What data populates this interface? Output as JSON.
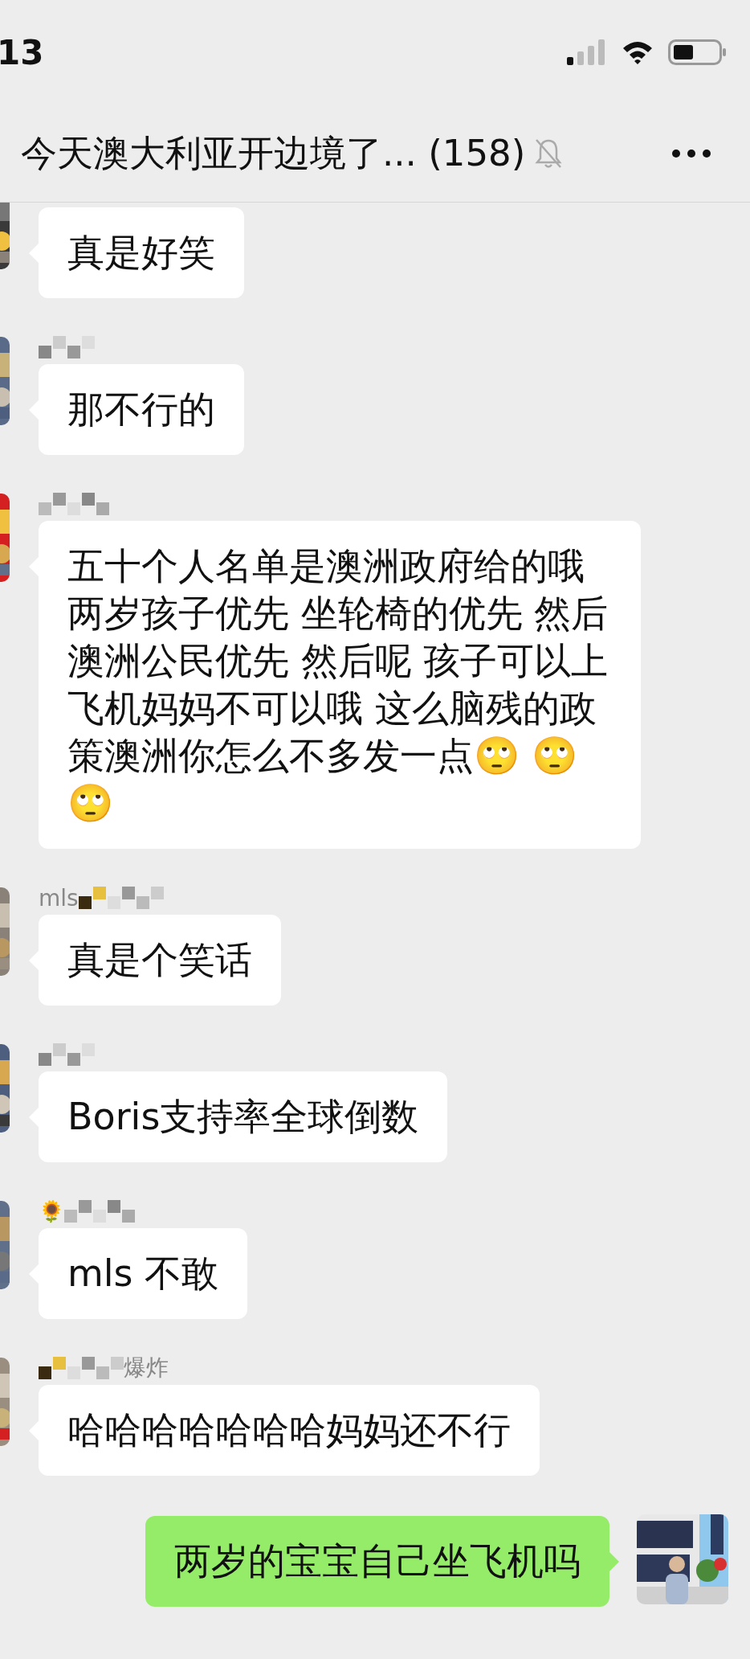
{
  "status_bar": {
    "time": "13"
  },
  "header": {
    "title": "今天澳大利亚开边境了... (158)",
    "muted": true
  },
  "messages": [
    {
      "kind": "received",
      "name_visible": false,
      "text": "真是好笑"
    },
    {
      "kind": "received",
      "name_visible": true,
      "text": "那不行的"
    },
    {
      "kind": "received",
      "name_visible": true,
      "text": "五十个人名单是澳洲政府给的哦两岁孩子优先 坐轮椅的优先 然后澳洲公民优先 然后呢 孩子可以上飞机妈妈不可以哦 这么脑残的政策澳洲你怎么不多发一点🙄 🙄 🙄"
    },
    {
      "kind": "received",
      "name_visible": true,
      "name_prefix": "mls",
      "text": "真是个笑话"
    },
    {
      "kind": "received",
      "name_visible": true,
      "text": "Boris支持率全球倒数"
    },
    {
      "kind": "received",
      "name_visible": true,
      "name_emoji": "🌻",
      "text": "mls 不敢"
    },
    {
      "kind": "received",
      "name_visible": true,
      "name_suffix": "爆炸",
      "text": "哈哈哈哈哈哈哈妈妈还不行"
    },
    {
      "kind": "sent",
      "text": "两岁的宝宝自己坐飞机吗"
    }
  ]
}
